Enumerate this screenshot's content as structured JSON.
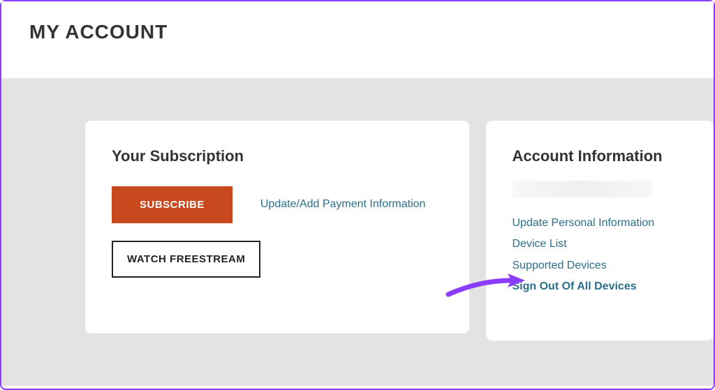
{
  "header": {
    "title": "MY ACCOUNT"
  },
  "subscription": {
    "title": "Your Subscription",
    "subscribe_label": "SUBSCRIBE",
    "freestream_label": "WATCH FREESTREAM",
    "payment_link": "Update/Add Payment Information"
  },
  "account": {
    "title": "Account Information",
    "links": {
      "update_personal": "Update Personal Information",
      "device_list": "Device List",
      "supported_devices": "Supported Devices",
      "sign_out_all": "Sign Out Of All Devices"
    }
  }
}
